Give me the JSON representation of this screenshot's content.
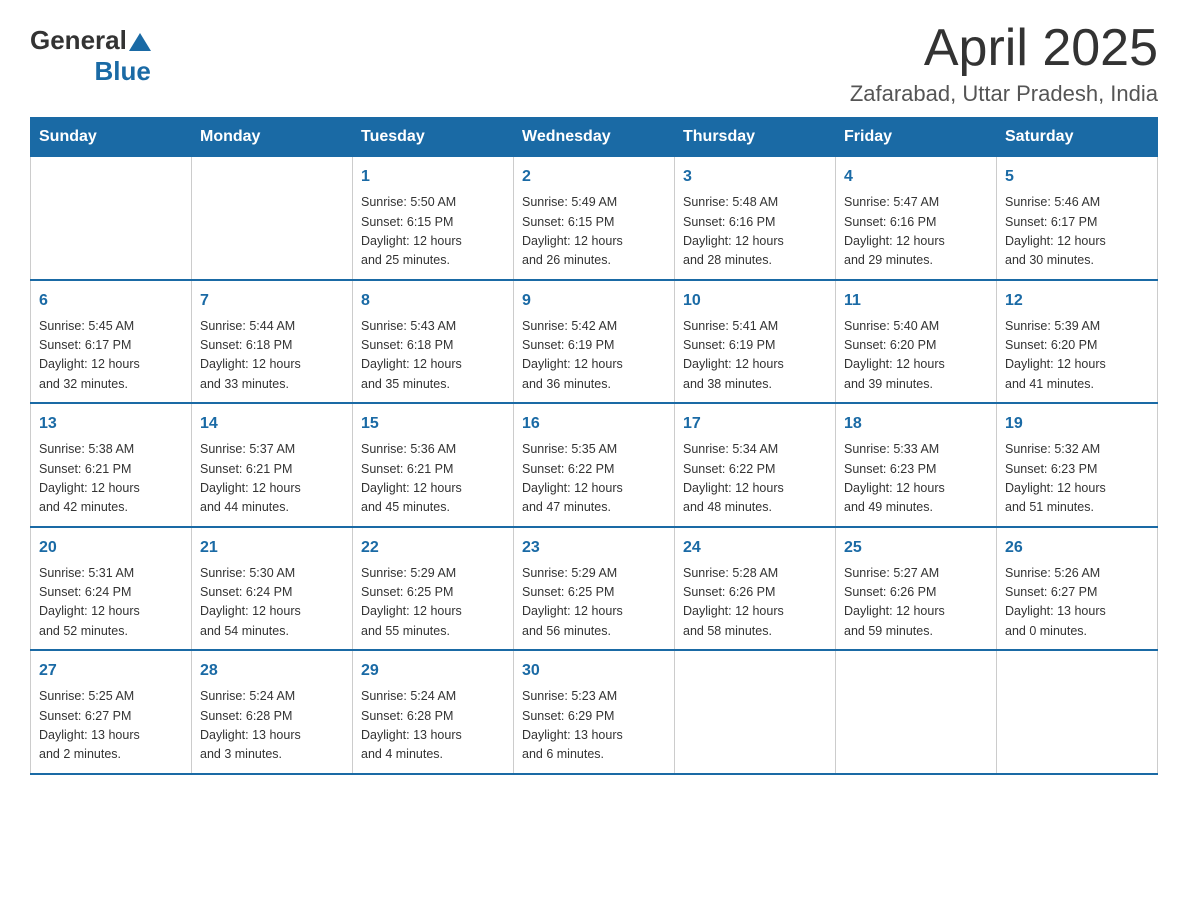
{
  "header": {
    "logo_general": "General",
    "logo_blue": "Blue",
    "month": "April 2025",
    "location": "Zafarabad, Uttar Pradesh, India"
  },
  "days_of_week": [
    "Sunday",
    "Monday",
    "Tuesday",
    "Wednesday",
    "Thursday",
    "Friday",
    "Saturday"
  ],
  "weeks": [
    [
      {
        "day": "",
        "info": ""
      },
      {
        "day": "",
        "info": ""
      },
      {
        "day": "1",
        "info": "Sunrise: 5:50 AM\nSunset: 6:15 PM\nDaylight: 12 hours\nand 25 minutes."
      },
      {
        "day": "2",
        "info": "Sunrise: 5:49 AM\nSunset: 6:15 PM\nDaylight: 12 hours\nand 26 minutes."
      },
      {
        "day": "3",
        "info": "Sunrise: 5:48 AM\nSunset: 6:16 PM\nDaylight: 12 hours\nand 28 minutes."
      },
      {
        "day": "4",
        "info": "Sunrise: 5:47 AM\nSunset: 6:16 PM\nDaylight: 12 hours\nand 29 minutes."
      },
      {
        "day": "5",
        "info": "Sunrise: 5:46 AM\nSunset: 6:17 PM\nDaylight: 12 hours\nand 30 minutes."
      }
    ],
    [
      {
        "day": "6",
        "info": "Sunrise: 5:45 AM\nSunset: 6:17 PM\nDaylight: 12 hours\nand 32 minutes."
      },
      {
        "day": "7",
        "info": "Sunrise: 5:44 AM\nSunset: 6:18 PM\nDaylight: 12 hours\nand 33 minutes."
      },
      {
        "day": "8",
        "info": "Sunrise: 5:43 AM\nSunset: 6:18 PM\nDaylight: 12 hours\nand 35 minutes."
      },
      {
        "day": "9",
        "info": "Sunrise: 5:42 AM\nSunset: 6:19 PM\nDaylight: 12 hours\nand 36 minutes."
      },
      {
        "day": "10",
        "info": "Sunrise: 5:41 AM\nSunset: 6:19 PM\nDaylight: 12 hours\nand 38 minutes."
      },
      {
        "day": "11",
        "info": "Sunrise: 5:40 AM\nSunset: 6:20 PM\nDaylight: 12 hours\nand 39 minutes."
      },
      {
        "day": "12",
        "info": "Sunrise: 5:39 AM\nSunset: 6:20 PM\nDaylight: 12 hours\nand 41 minutes."
      }
    ],
    [
      {
        "day": "13",
        "info": "Sunrise: 5:38 AM\nSunset: 6:21 PM\nDaylight: 12 hours\nand 42 minutes."
      },
      {
        "day": "14",
        "info": "Sunrise: 5:37 AM\nSunset: 6:21 PM\nDaylight: 12 hours\nand 44 minutes."
      },
      {
        "day": "15",
        "info": "Sunrise: 5:36 AM\nSunset: 6:21 PM\nDaylight: 12 hours\nand 45 minutes."
      },
      {
        "day": "16",
        "info": "Sunrise: 5:35 AM\nSunset: 6:22 PM\nDaylight: 12 hours\nand 47 minutes."
      },
      {
        "day": "17",
        "info": "Sunrise: 5:34 AM\nSunset: 6:22 PM\nDaylight: 12 hours\nand 48 minutes."
      },
      {
        "day": "18",
        "info": "Sunrise: 5:33 AM\nSunset: 6:23 PM\nDaylight: 12 hours\nand 49 minutes."
      },
      {
        "day": "19",
        "info": "Sunrise: 5:32 AM\nSunset: 6:23 PM\nDaylight: 12 hours\nand 51 minutes."
      }
    ],
    [
      {
        "day": "20",
        "info": "Sunrise: 5:31 AM\nSunset: 6:24 PM\nDaylight: 12 hours\nand 52 minutes."
      },
      {
        "day": "21",
        "info": "Sunrise: 5:30 AM\nSunset: 6:24 PM\nDaylight: 12 hours\nand 54 minutes."
      },
      {
        "day": "22",
        "info": "Sunrise: 5:29 AM\nSunset: 6:25 PM\nDaylight: 12 hours\nand 55 minutes."
      },
      {
        "day": "23",
        "info": "Sunrise: 5:29 AM\nSunset: 6:25 PM\nDaylight: 12 hours\nand 56 minutes."
      },
      {
        "day": "24",
        "info": "Sunrise: 5:28 AM\nSunset: 6:26 PM\nDaylight: 12 hours\nand 58 minutes."
      },
      {
        "day": "25",
        "info": "Sunrise: 5:27 AM\nSunset: 6:26 PM\nDaylight: 12 hours\nand 59 minutes."
      },
      {
        "day": "26",
        "info": "Sunrise: 5:26 AM\nSunset: 6:27 PM\nDaylight: 13 hours\nand 0 minutes."
      }
    ],
    [
      {
        "day": "27",
        "info": "Sunrise: 5:25 AM\nSunset: 6:27 PM\nDaylight: 13 hours\nand 2 minutes."
      },
      {
        "day": "28",
        "info": "Sunrise: 5:24 AM\nSunset: 6:28 PM\nDaylight: 13 hours\nand 3 minutes."
      },
      {
        "day": "29",
        "info": "Sunrise: 5:24 AM\nSunset: 6:28 PM\nDaylight: 13 hours\nand 4 minutes."
      },
      {
        "day": "30",
        "info": "Sunrise: 5:23 AM\nSunset: 6:29 PM\nDaylight: 13 hours\nand 6 minutes."
      },
      {
        "day": "",
        "info": ""
      },
      {
        "day": "",
        "info": ""
      },
      {
        "day": "",
        "info": ""
      }
    ]
  ]
}
